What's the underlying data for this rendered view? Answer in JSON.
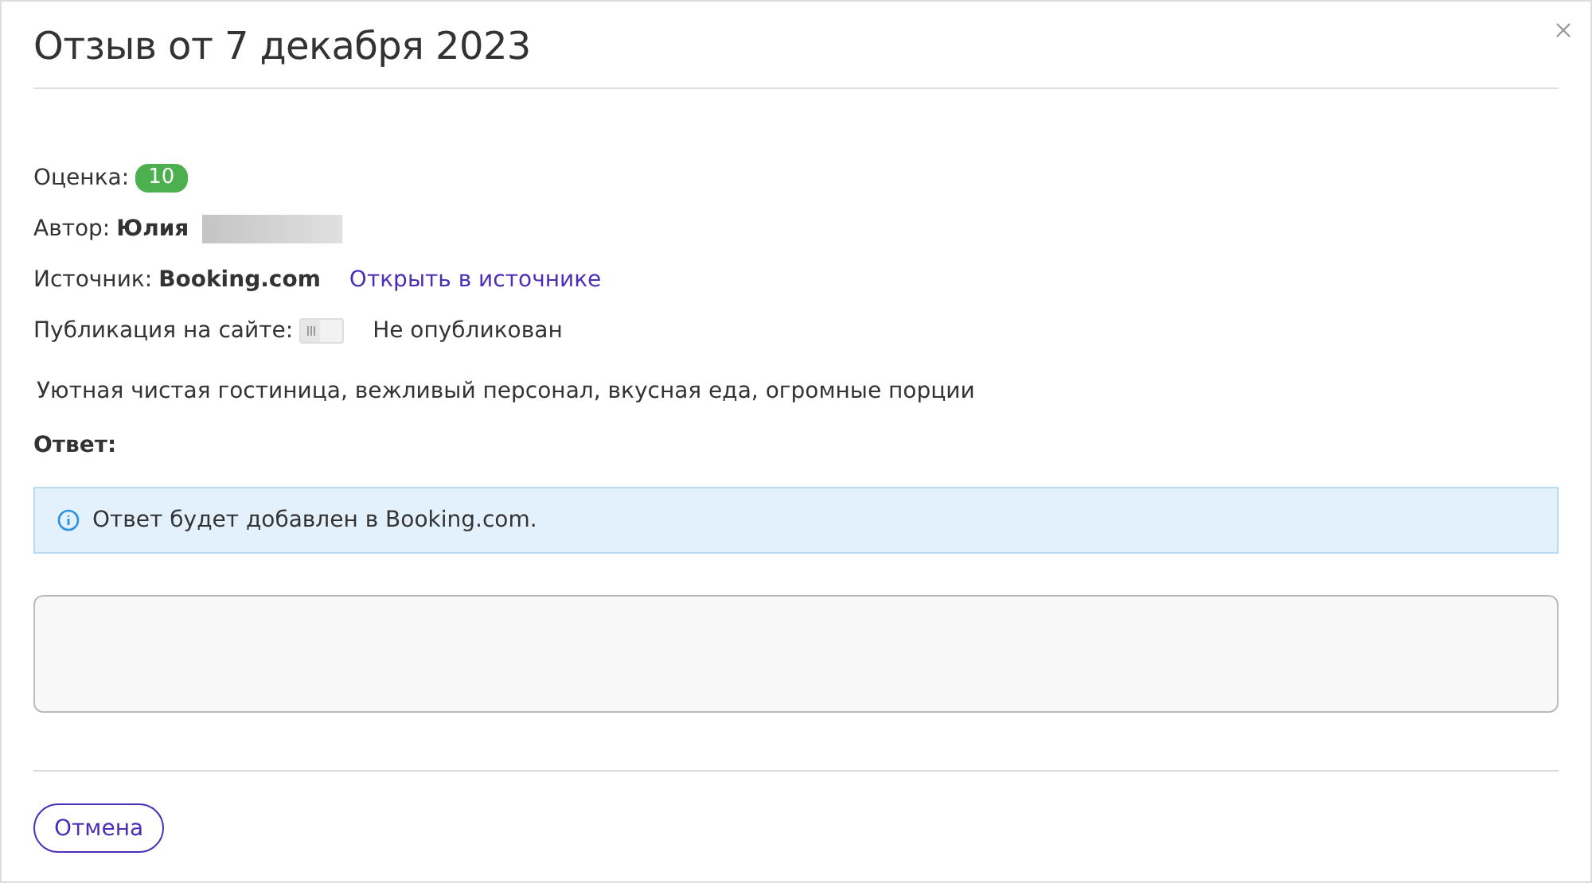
{
  "title": "Отзыв от 7 декабря 2023",
  "rating": {
    "label": "Оценка:",
    "value": "10"
  },
  "author": {
    "label": "Автор:",
    "name": "Юлия"
  },
  "source": {
    "label": "Источник:",
    "name": "Booking.com",
    "link": "Открыть в источнике"
  },
  "publication": {
    "label": "Публикация на сайте:",
    "on": false,
    "status": "Не опубликован"
  },
  "review_text": "Уютная чистая гостиница, вежливый персонал, вкусная еда, огромные порции",
  "answer": {
    "label": "Ответ:",
    "notice": "Ответ будет добавлен в Booking.com."
  },
  "buttons": [
    "Отмена"
  ]
}
